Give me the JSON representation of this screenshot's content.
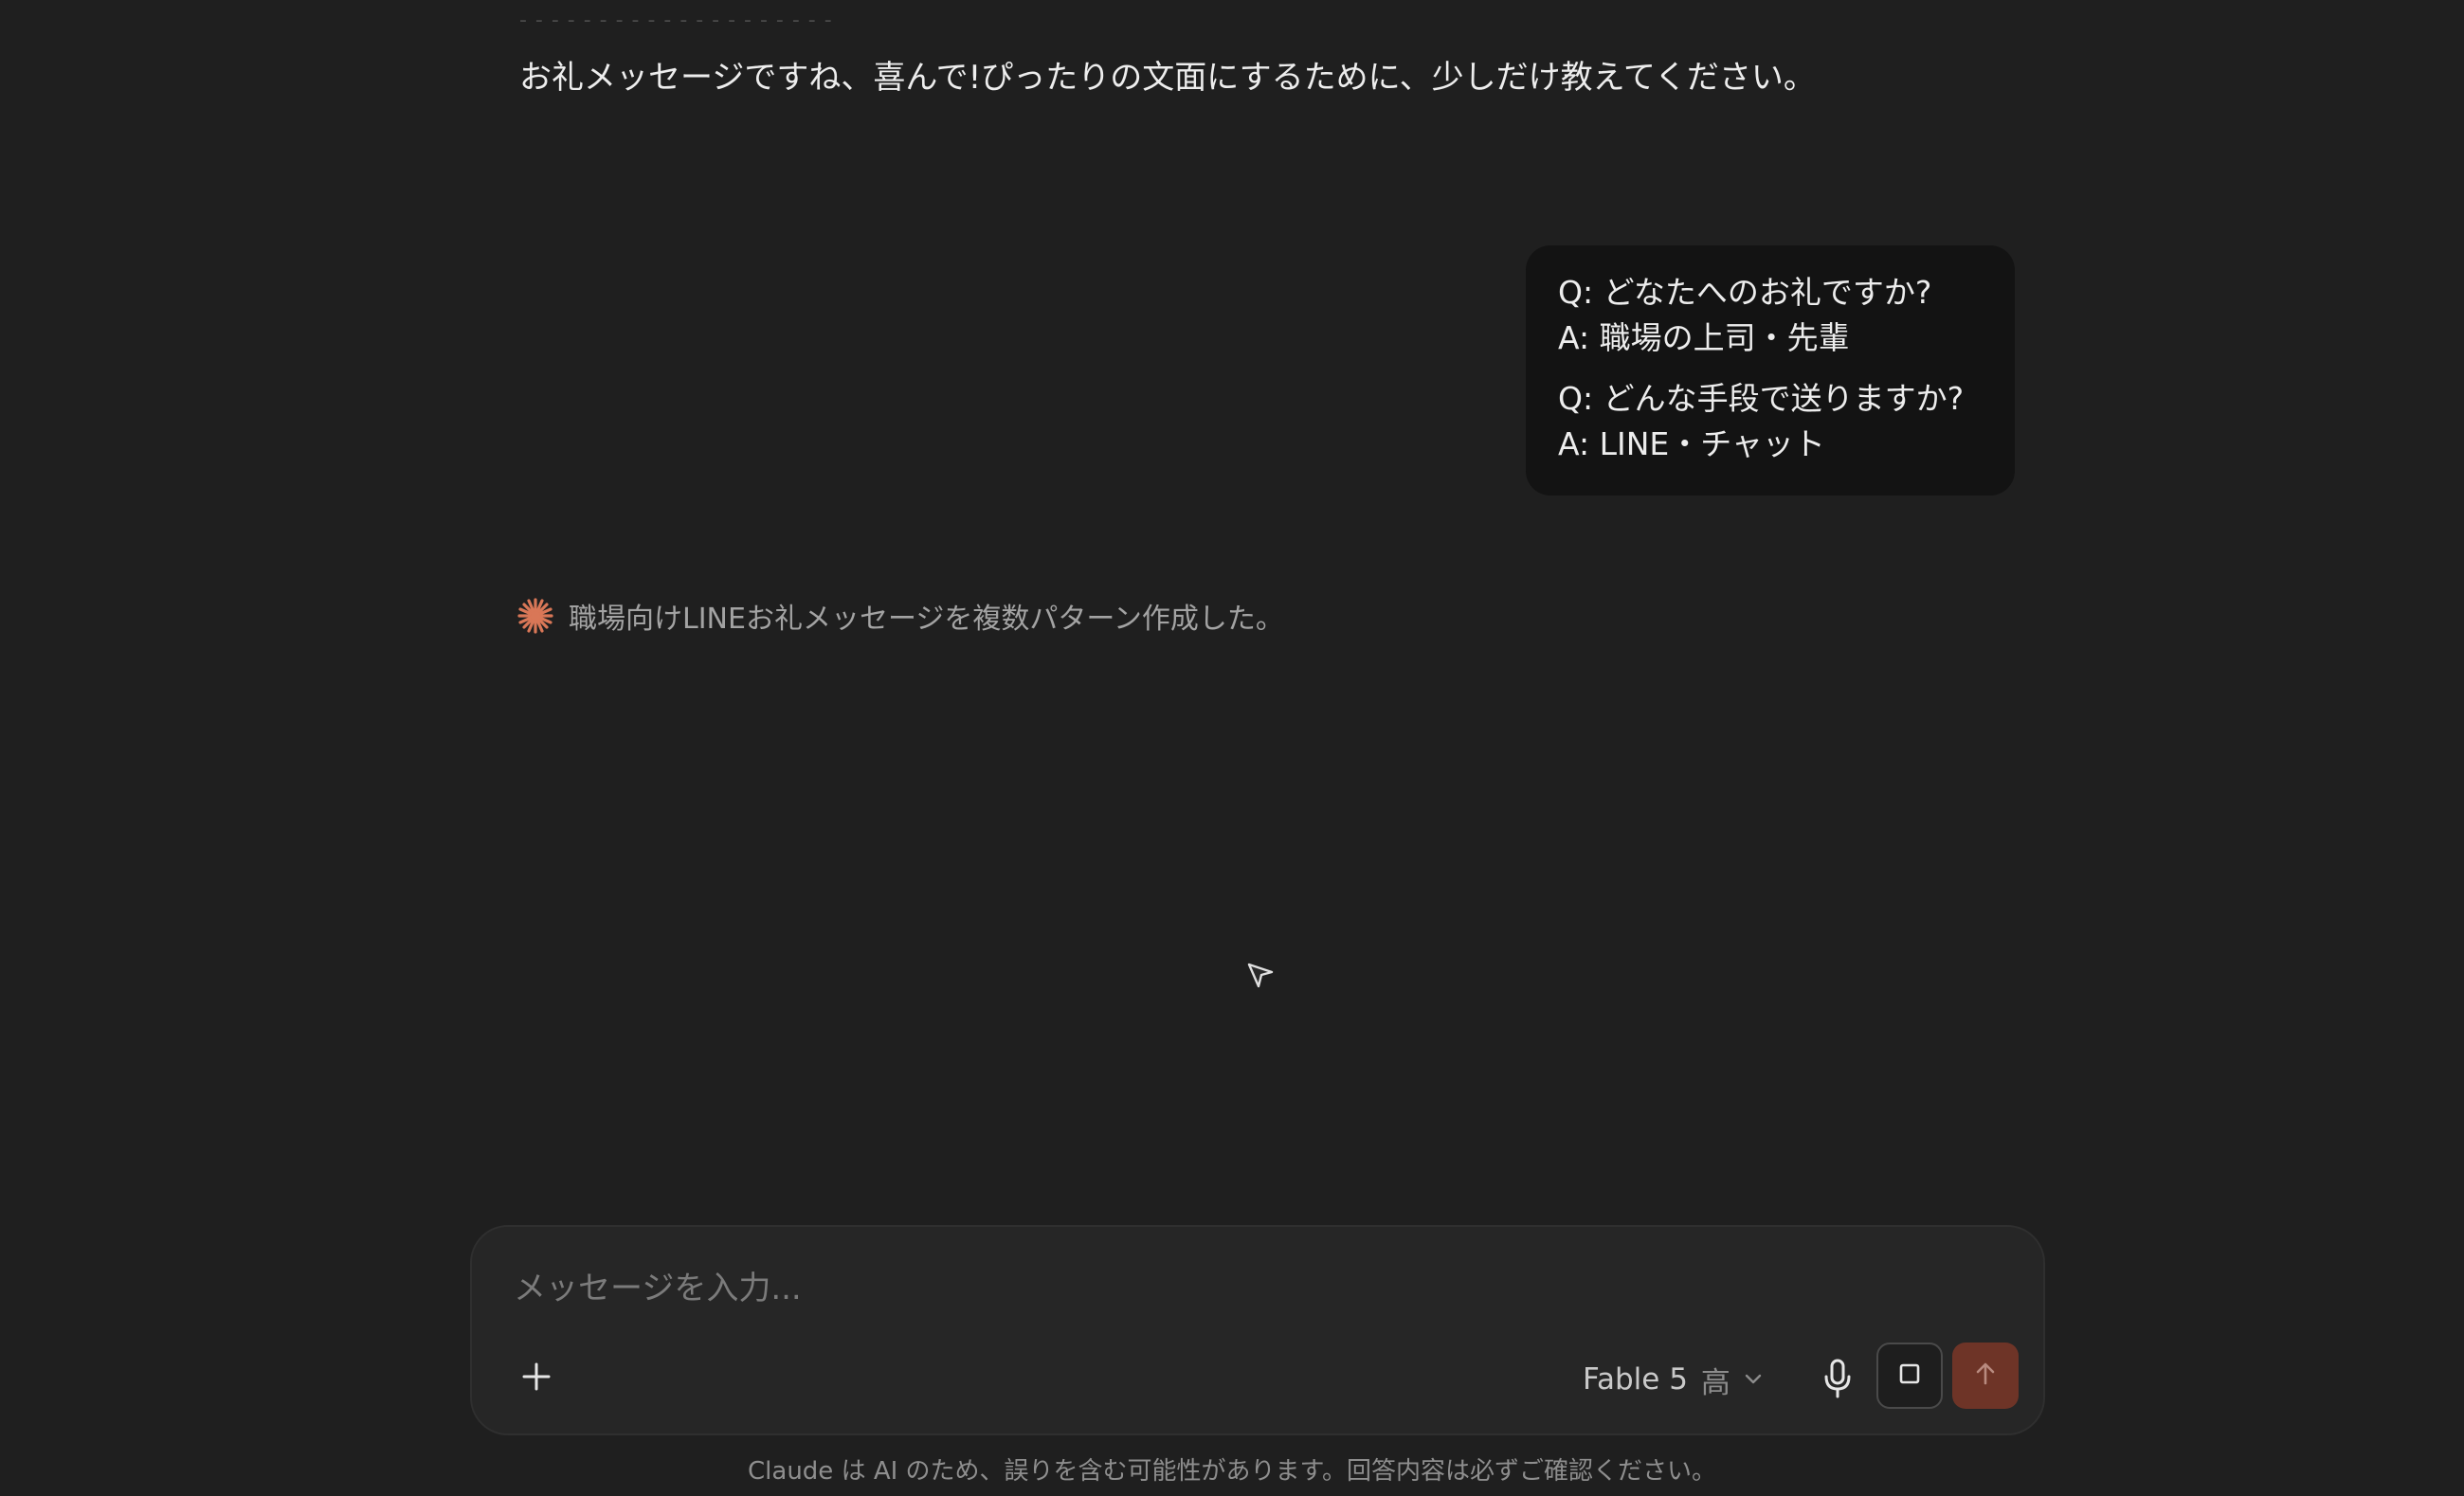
{
  "conversation": {
    "faded_previous_text": "- - - - - - - - - - - - - - - - - - - -",
    "assistant_message": "お礼メッセージですね、喜んで!ぴったりの文面にするために、少しだけ教えてください。",
    "user_answers": [
      {
        "question": "Q: どなたへのお礼ですか?",
        "answer": "A: 職場の上司・先輩"
      },
      {
        "question": "Q: どんな手段で送りますか?",
        "answer": "A: LINE・チャット"
      }
    ],
    "status": {
      "icon": "claude-spark-icon",
      "accent_color": "#d97757",
      "text": "職場向けLINEお礼メッセージを複数パターン作成した。"
    }
  },
  "composer": {
    "placeholder": "メッセージを入力...",
    "value": "",
    "model_name": "Fable 5",
    "model_effort": "高",
    "icons": {
      "add": "plus-icon",
      "model_dropdown": "chevron-down-icon",
      "mic": "microphone-icon",
      "stop": "stop-square-icon",
      "send": "arrow-up-icon"
    },
    "send_color": "#6e3427"
  },
  "footer": {
    "disclaimer": "Claude は AI のため、誤りを含む可能性があります。回答内容は必ずご確認ください。"
  }
}
